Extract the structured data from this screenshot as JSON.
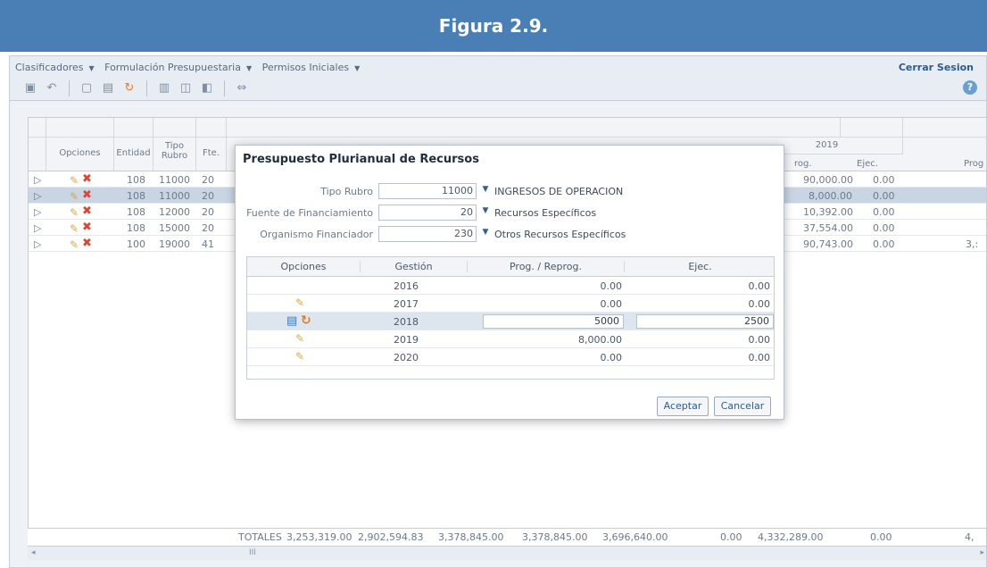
{
  "banner": {
    "title": "Figura 2.9."
  },
  "menubar": {
    "items": [
      "Clasificadores",
      "Formulación Presupuestaria",
      "Permisos Iniciales"
    ],
    "logout": "Cerrar Sesion"
  },
  "grid": {
    "headers": {
      "opciones": "Opciones",
      "entidad": "Entidad",
      "tipo_rubro": "Tipo Rubro",
      "fte": "Fte.",
      "year": "2019",
      "prog": "rog.",
      "ejec": "Ejec.",
      "prog2": "Prog"
    },
    "rows": [
      {
        "entidad": "108",
        "tipo": "11000",
        "fte": "20",
        "prog": "90,000.00",
        "ejec": "0.00",
        "extra": ""
      },
      {
        "entidad": "108",
        "tipo": "11000",
        "fte": "20",
        "prog": "8,000.00",
        "ejec": "0.00",
        "extra": ""
      },
      {
        "entidad": "108",
        "tipo": "12000",
        "fte": "20",
        "prog": "10,392.00",
        "ejec": "0.00",
        "extra": ""
      },
      {
        "entidad": "108",
        "tipo": "15000",
        "fte": "20",
        "prog": "37,554.00",
        "ejec": "0.00",
        "extra": ""
      },
      {
        "entidad": "100",
        "tipo": "19000",
        "fte": "41",
        "prog": "90,743.00",
        "ejec": "0.00",
        "extra": "3,:"
      }
    ],
    "totals": {
      "label": "TOTALES",
      "values": [
        "3,253,319.00",
        "2,902,594.83",
        "3,378,845.00",
        "3,378,845.00",
        "3,696,640.00",
        "0.00",
        "4,332,289.00",
        "0.00",
        "4,"
      ]
    },
    "scroll_glyph": "III"
  },
  "dialog": {
    "title": "Presupuesto Plurianual de Recursos",
    "fields": [
      {
        "label": "Tipo Rubro",
        "value": "11000",
        "desc": "INGRESOS DE OPERACION"
      },
      {
        "label": "Fuente de Financiamiento",
        "value": "20",
        "desc": "Recursos Específicos"
      },
      {
        "label": "Organismo Financiador",
        "value": "230",
        "desc": "Otros Recursos Específicos"
      }
    ],
    "table": {
      "headers": [
        "Opciones",
        "Gestión",
        "Prog. / Reprog.",
        "Ejec."
      ],
      "rows": [
        {
          "gestion": "2016",
          "prog": "0.00",
          "ejec": "0.00",
          "mode": "none"
        },
        {
          "gestion": "2017",
          "prog": "0.00",
          "ejec": "0.00",
          "mode": "edit"
        },
        {
          "gestion": "2018",
          "prog": "5000",
          "ejec": "2500",
          "mode": "editing"
        },
        {
          "gestion": "2019",
          "prog": "8,000.00",
          "ejec": "0.00",
          "mode": "edit"
        },
        {
          "gestion": "2020",
          "prog": "0.00",
          "ejec": "0.00",
          "mode": "edit"
        }
      ]
    },
    "accept": "Aceptar",
    "cancel": "Cancelar"
  }
}
